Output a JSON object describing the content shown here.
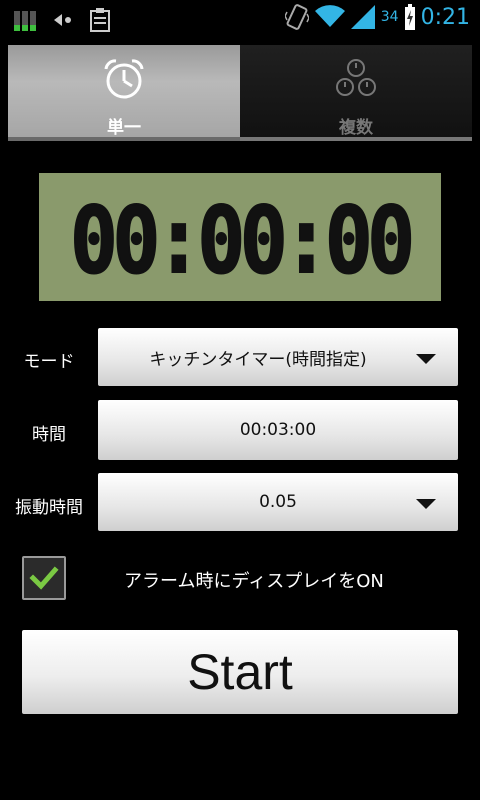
{
  "status_bar": {
    "battery_percent": "34",
    "time": "0:21",
    "icons": [
      "signal-bars-icon",
      "back-arrow-icon",
      "clipboard-icon",
      "vibrate-icon",
      "wifi-icon",
      "cell-signal-icon",
      "battery-icon"
    ]
  },
  "tabs": [
    {
      "label": "単一",
      "icon": "alarm-clock-icon",
      "active": true
    },
    {
      "label": "複数",
      "icon": "multiple-alarms-icon",
      "active": false
    }
  ],
  "display": {
    "time": "00:00:00",
    "background": "#8a9a6c"
  },
  "form": {
    "mode": {
      "label": "モード",
      "value": "キッチンタイマー(時間指定)"
    },
    "time": {
      "label": "時間",
      "value": "00:03:00"
    },
    "vibration": {
      "label": "振動時間",
      "value": "0.05"
    }
  },
  "checkbox": {
    "label": "アラーム時にディスプレイをON",
    "checked": true,
    "check_color": "#7ac943"
  },
  "start_button": {
    "label": "Start"
  },
  "colors": {
    "accent": "#33b5e5"
  }
}
